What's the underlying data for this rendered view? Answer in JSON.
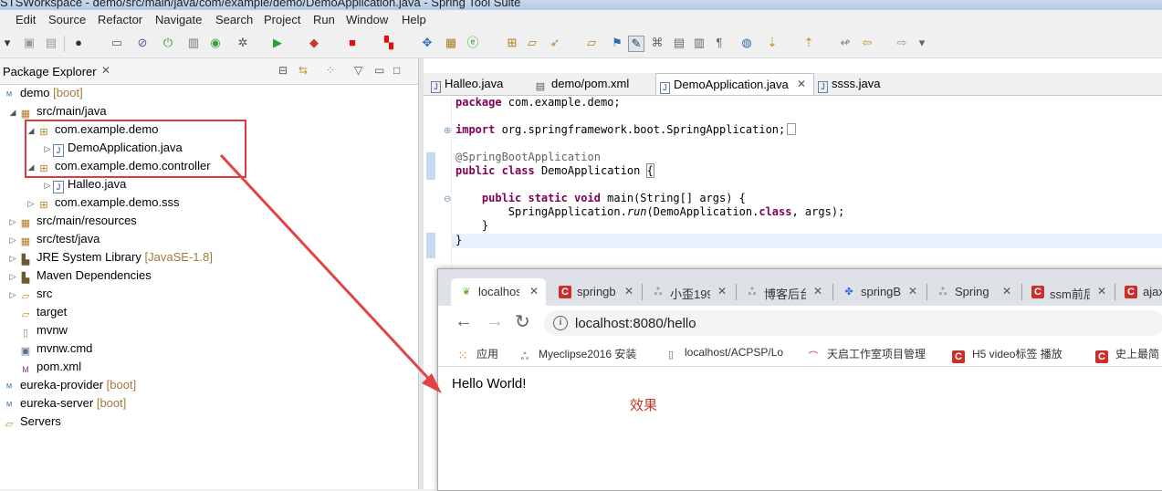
{
  "window": {
    "title": "STSWorkspace - demo/src/main/java/com/example/demo/DemoApplication.java - Spring Tool Suite"
  },
  "menu": [
    "Edit",
    "Source",
    "Refactor",
    "Navigate",
    "Search",
    "Project",
    "Run",
    "Window",
    "Help"
  ],
  "package_explorer": {
    "title": "Package Explorer",
    "close": "✕",
    "tree": [
      {
        "label": "demo",
        "decor": "[boot]"
      },
      {
        "label": "src/main/java",
        "decor": ""
      },
      {
        "label": "com.example.demo",
        "decor": ""
      },
      {
        "label": "DemoApplication.java",
        "decor": ""
      },
      {
        "label": "com.example.demo.controller",
        "decor": ""
      },
      {
        "label": "Halleo.java",
        "decor": ""
      },
      {
        "label": "com.example.demo.sss",
        "decor": ""
      },
      {
        "label": "src/main/resources",
        "decor": ""
      },
      {
        "label": "src/test/java",
        "decor": ""
      },
      {
        "label": "JRE System Library",
        "decor": "[JavaSE-1.8]"
      },
      {
        "label": "Maven Dependencies",
        "decor": ""
      },
      {
        "label": "src",
        "decor": ""
      },
      {
        "label": "target",
        "decor": ""
      },
      {
        "label": "mvnw",
        "decor": ""
      },
      {
        "label": "mvnw.cmd",
        "decor": ""
      },
      {
        "label": "pom.xml",
        "decor": ""
      },
      {
        "label": "eureka-provider",
        "decor": "[boot]"
      },
      {
        "label": "eureka-server",
        "decor": "[boot]"
      },
      {
        "label": "Servers",
        "decor": ""
      }
    ]
  },
  "editor": {
    "tabs": [
      "Halleo.java",
      "demo/pom.xml",
      "DemoApplication.java",
      "ssss.java"
    ],
    "active_close": "✕",
    "code": {
      "package_kw": "package",
      "package_name": " com.example.demo;",
      "import_kw": "import",
      "import_name": " org.springframework.boot.SpringApplication;",
      "annotation": "@SpringBootApplication",
      "public_kw": "public",
      "class_kw": "class",
      "class_name": " DemoApplication ",
      "brace_open": "{",
      "main_mods": "public static void",
      "main_sig": " main(String[] args) {",
      "run_prefix": "SpringApplication.",
      "run_method": "run",
      "run_args_a": "(DemoApplication.",
      "run_class_kw": "class",
      "run_args_b": ", args);",
      "close1": "}",
      "close2": "}"
    }
  },
  "browser": {
    "tabs": [
      {
        "label": "localhos",
        "icon": "leaf-icon",
        "color": "#6db33f"
      },
      {
        "label": "springb",
        "icon": "c-icon",
        "color": "#c9302c"
      },
      {
        "label": "小歪199",
        "icon": "wave-icon",
        "color": "#555555"
      },
      {
        "label": "博客后台",
        "icon": "wave-icon",
        "color": "#555555"
      },
      {
        "label": "springB",
        "icon": "paw-icon",
        "color": "#2f6fd6"
      },
      {
        "label": "Spring",
        "icon": "wave-icon",
        "color": "#555555"
      },
      {
        "label": "ssm前后",
        "icon": "c-icon",
        "color": "#c9302c"
      },
      {
        "label": "ajax",
        "icon": "c-icon",
        "color": "#c9302c"
      }
    ],
    "url": "localhost:8080/hello",
    "bookmarks": [
      {
        "label": "应用",
        "icon": "apps-icon"
      },
      {
        "label": "Myeclipse2016 安装",
        "icon": "wave-icon"
      },
      {
        "label": "localhost/ACPSP/Lo",
        "icon": "page-icon"
      },
      {
        "label": "天启工作室项目管理",
        "icon": "arc-icon"
      },
      {
        "label": "H5 video标签 播放",
        "icon": "c-icon"
      },
      {
        "label": "史上最简",
        "icon": "c-icon"
      }
    ],
    "content": "Hello World!",
    "annotation": "效果"
  },
  "colors": {
    "highlight_box": "#e03a3a",
    "arrow": "#e04545",
    "annotation": "#c0392b"
  }
}
